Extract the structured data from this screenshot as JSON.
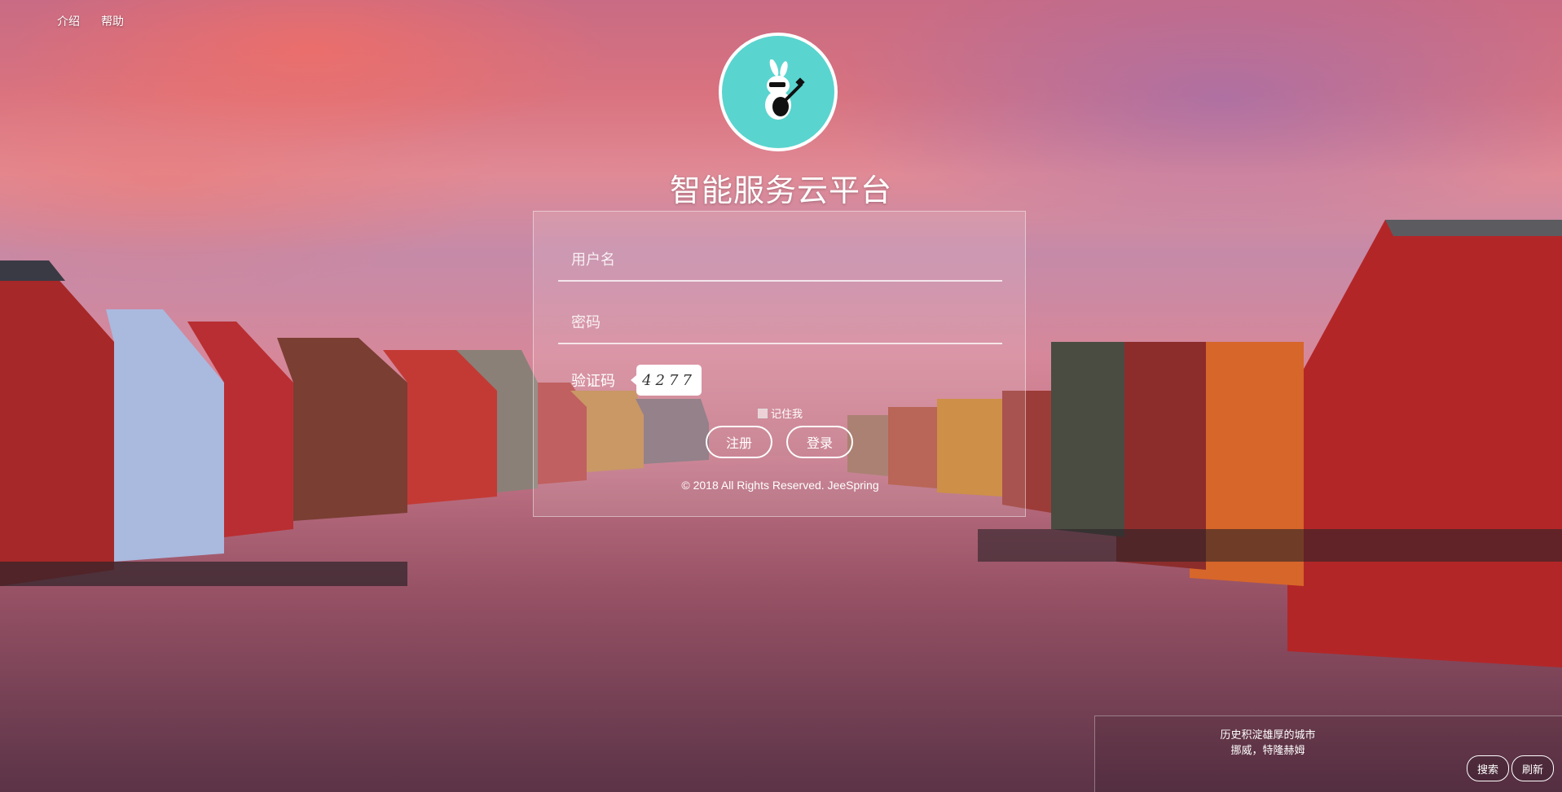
{
  "topnav": {
    "intro": "介绍",
    "help": "帮助"
  },
  "app": {
    "title": "智能服务云平台",
    "logo_icon": "rabbit-guitar-logo",
    "logo_color": "#5ad4cf"
  },
  "login": {
    "username_placeholder": "用户名",
    "password_placeholder": "密码",
    "captcha_label": "验证码",
    "captcha_code": "4277",
    "remember_label": "记住我",
    "register_label": "注册",
    "login_label": "登录",
    "copyright": "© 2018 All Rights Reserved. JeeSpring"
  },
  "caption": {
    "line1": "历史积淀雄厚的城市",
    "line2": "挪威，特隆赫姆",
    "search_label": "搜索",
    "refresh_label": "刷新"
  }
}
